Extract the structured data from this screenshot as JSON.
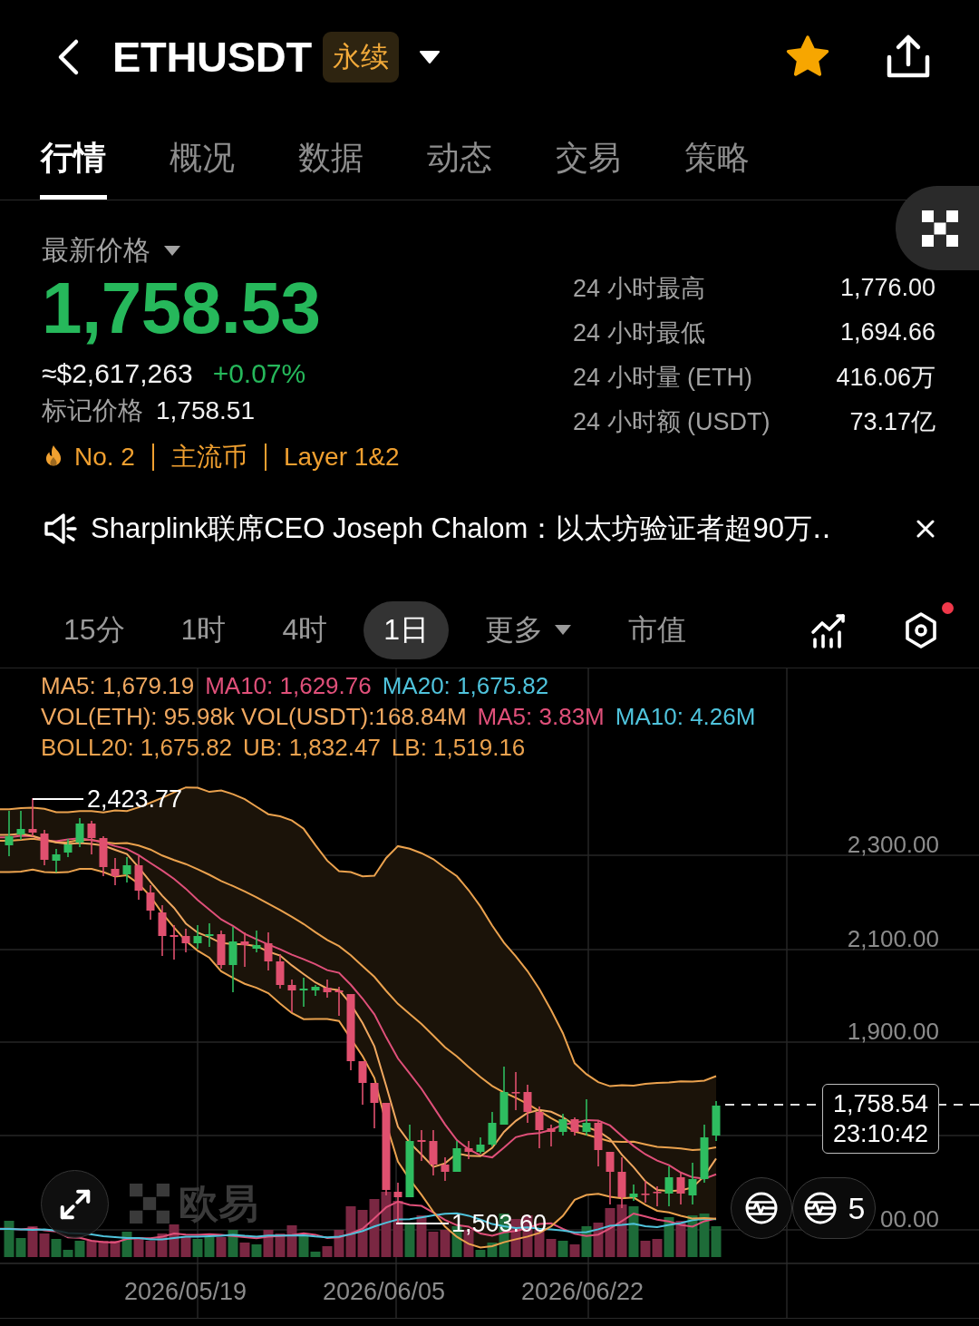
{
  "header": {
    "symbol": "ETHUSDT",
    "badge": "永续",
    "favorite": true
  },
  "tabs": [
    {
      "label": "行情",
      "selected": true
    },
    {
      "label": "概况",
      "selected": false
    },
    {
      "label": "数据",
      "selected": false
    },
    {
      "label": "动态",
      "selected": false
    },
    {
      "label": "交易",
      "selected": false
    },
    {
      "label": "策略",
      "selected": false
    }
  ],
  "price": {
    "label": "最新价格",
    "last": "1,758.53",
    "usd_value": "≈$2,617,263",
    "change": "+0.07%",
    "mark_label": "标记价格",
    "mark_value": "1,758.51",
    "tags": [
      "No. 2",
      "主流币",
      "Layer 1&2"
    ]
  },
  "stats": [
    {
      "label": "24 小时最高",
      "value": "1,776.00"
    },
    {
      "label": "24 小时最低",
      "value": "1,694.66"
    },
    {
      "label": "24 小时量 (ETH)",
      "value": "416.06万"
    },
    {
      "label": "24 小时额 (USDT)",
      "value": "73.17亿"
    }
  ],
  "news": {
    "text": "Sharplink联席CEO Joseph Chalom：以太坊验证者超90万‥"
  },
  "intervals": [
    {
      "label": "15分",
      "kind": "interval",
      "selected": false
    },
    {
      "label": "1时",
      "kind": "interval",
      "selected": false
    },
    {
      "label": "4时",
      "kind": "interval",
      "selected": false
    },
    {
      "label": "1日",
      "kind": "interval",
      "selected": true
    },
    {
      "label": "更多",
      "kind": "menu",
      "selected": false
    },
    {
      "label": "市值",
      "kind": "interval",
      "selected": false
    }
  ],
  "toolbar": {
    "settings_badge": true
  },
  "chart": {
    "legend": [
      {
        "items": [
          {
            "text": "MA5: 1,679.19",
            "color": "#f0a860"
          },
          {
            "text": "MA10: 1,629.76",
            "color": "#e0507a"
          },
          {
            "text": "MA20: 1,675.82",
            "color": "#4fc3dc"
          }
        ]
      },
      {
        "items": [
          {
            "text": "VOL(ETH): 95.98k VOL(USDT):168.84M",
            "color": "#f0a860"
          },
          {
            "text": "MA5: 3.83M",
            "color": "#e0507a"
          },
          {
            "text": "MA10: 4.26M",
            "color": "#4fc3dc"
          }
        ]
      },
      {
        "items": [
          {
            "text": "BOLL20: 1,675.82",
            "color": "#eba24e"
          },
          {
            "text": "UB: 1,832.47",
            "color": "#eba24e"
          },
          {
            "text": "LB: 1,519.16",
            "color": "#eba24e"
          }
        ]
      }
    ],
    "high_label": "2,423.77",
    "low_label": "1,503.60",
    "current_price": "1,758.54",
    "countdown": "23:10:42",
    "y_labels": [
      "2,300.00",
      "2,100.00",
      "1,900.00",
      "00.00"
    ],
    "x_labels": [
      "2026/05/19",
      "2026/06/05",
      "2026/06/22"
    ],
    "watermark": "欧易",
    "indicator_count": "5"
  }
}
